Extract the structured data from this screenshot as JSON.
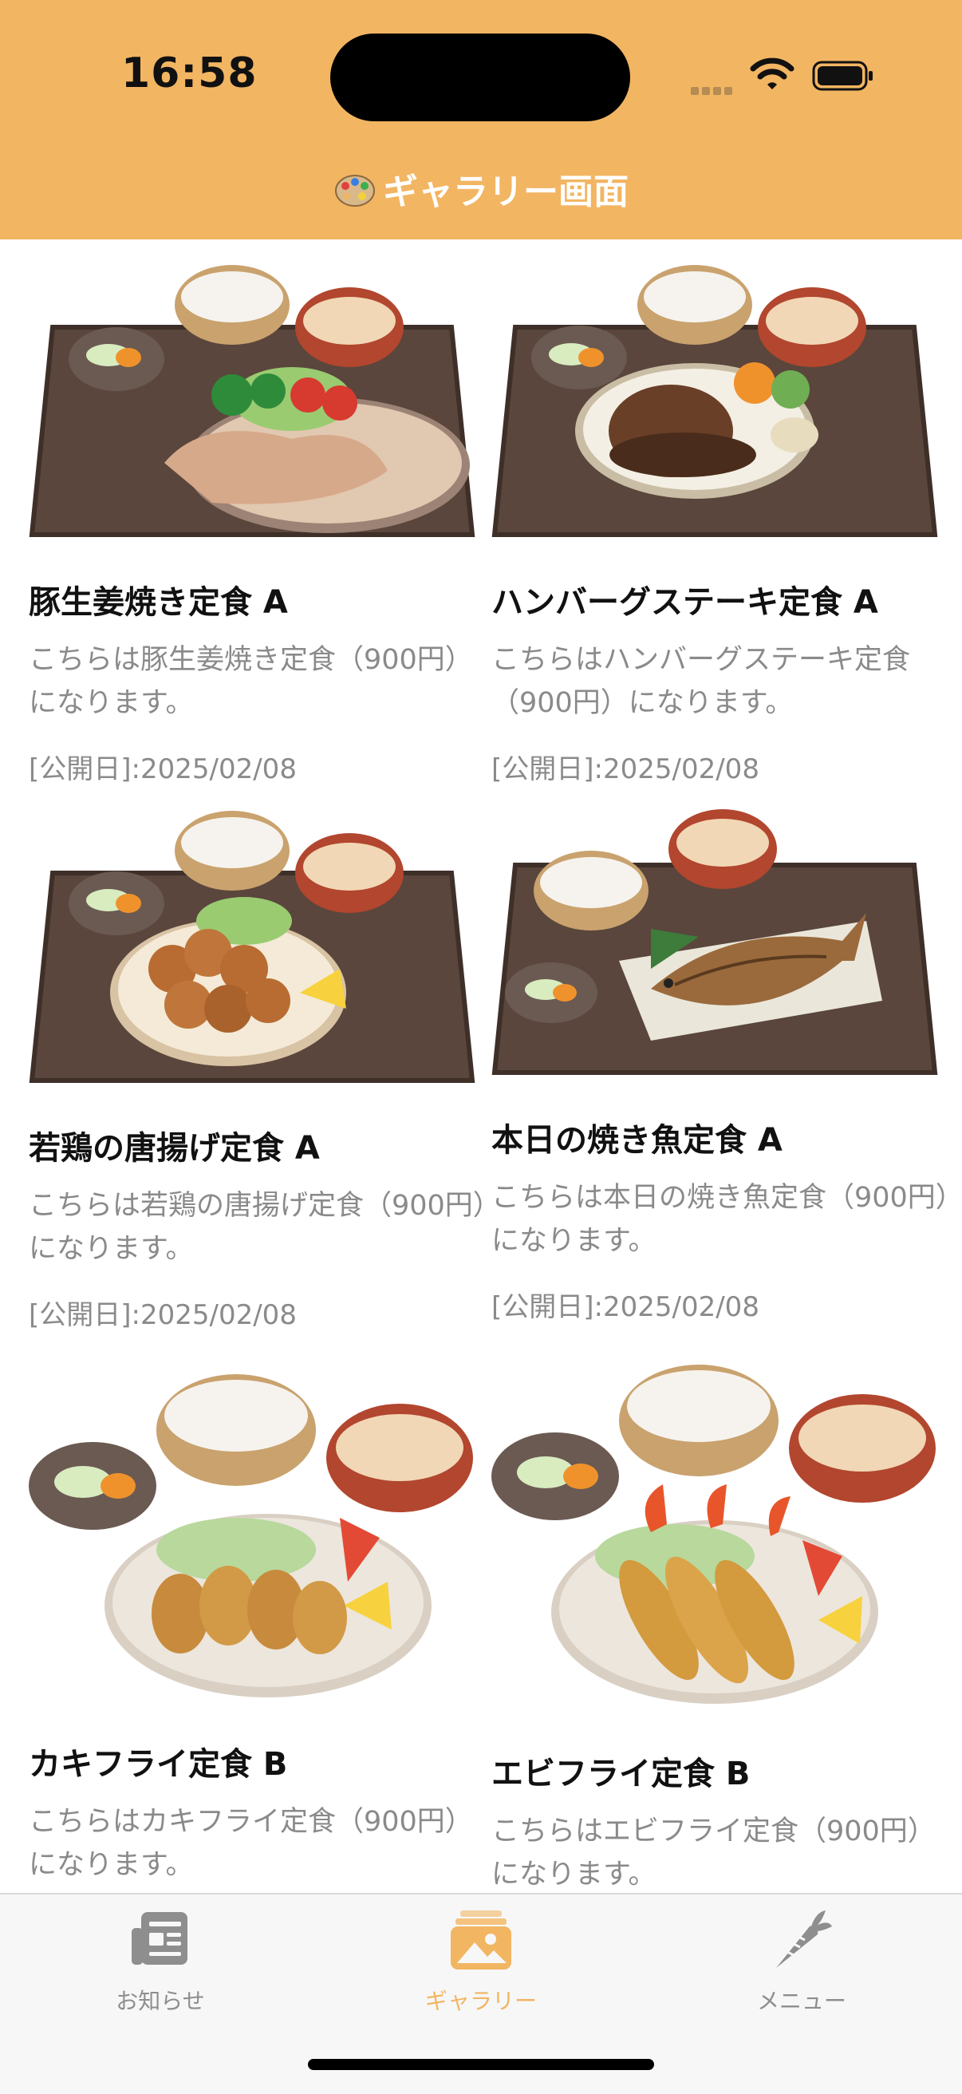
{
  "status_bar": {
    "time": "16:58"
  },
  "nav": {
    "title": "ギャラリー画面",
    "icon": "palette-icon"
  },
  "items": [
    {
      "title": "豚生姜焼き定食 A",
      "description": "こちらは豚生姜焼き定食（900円）になります。",
      "date": "[公開日]:2025/02/08",
      "dish": "ginger-pork-set"
    },
    {
      "title": "ハンバーグステーキ定食 A",
      "description": "こちらはハンバーグステーキ定食（900円）になります。",
      "date": "[公開日]:2025/02/08",
      "dish": "hamburg-steak-set"
    },
    {
      "title": "若鶏の唐揚げ定食 A",
      "description": "こちらは若鶏の唐揚げ定食（900円）になります。",
      "date": "[公開日]:2025/02/08",
      "dish": "karaage-set"
    },
    {
      "title": "本日の焼き魚定食 A",
      "description": "こちらは本日の焼き魚定食（900円）になります。",
      "date": "[公開日]:2025/02/08",
      "dish": "grilled-fish-set"
    },
    {
      "title": "カキフライ定食 B",
      "description": "こちらはカキフライ定食（900円）になります。",
      "dish": "fried-oyster-set"
    },
    {
      "title": "エビフライ定食 B",
      "description": "こちらはエビフライ定食（900円）になります。",
      "dish": "fried-shrimp-set"
    }
  ],
  "tabbar": {
    "tabs": [
      {
        "label": "お知らせ",
        "icon": "newspaper-icon",
        "active": false
      },
      {
        "label": "ギャラリー",
        "icon": "photo-icon",
        "active": true
      },
      {
        "label": "メニュー",
        "icon": "carrot-icon",
        "active": false
      }
    ]
  },
  "colors": {
    "accent": "#F2B562",
    "header_bg": "#F2B562",
    "tab_inactive": "#8E8E8E"
  }
}
